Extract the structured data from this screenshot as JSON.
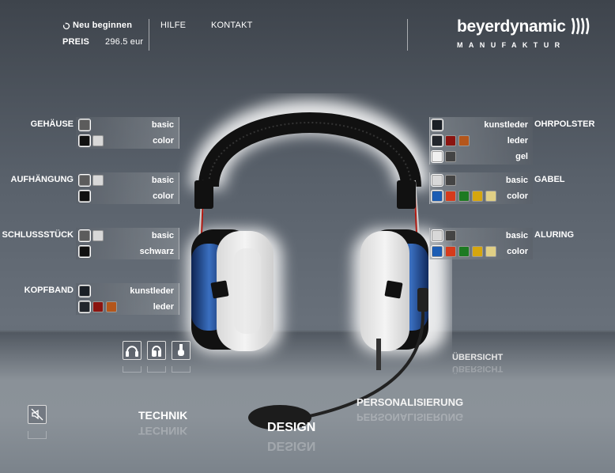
{
  "header": {
    "restart_icon": "restart-icon",
    "restart_label": "Neu beginnen",
    "price_label": "PREIS",
    "price_value": "296.5 eur",
    "menu": [
      "HILFE",
      "KONTAKT"
    ],
    "brand": "beyerdynamic",
    "brand_sub": "MANUFAKTUR"
  },
  "left": [
    {
      "category": "GEHÄUSE",
      "rows": [
        {
          "label": "basic",
          "swatches": [
            "#5c5c5c"
          ]
        },
        {
          "label": "color",
          "swatches": [
            "#111111",
            "#d8d8d8"
          ]
        }
      ]
    },
    {
      "category": "AUFHÄNGUNG",
      "rows": [
        {
          "label": "basic",
          "swatches": [
            "#5c5c5c",
            "#d8d8d8"
          ]
        },
        {
          "label": "color",
          "swatches": [
            "#111111"
          ]
        }
      ]
    },
    {
      "category": "SCHLUSSSTÜCK",
      "rows": [
        {
          "label": "basic",
          "swatches": [
            "#5c5c5c",
            "#d8d8d8"
          ]
        },
        {
          "label": "schwarz",
          "swatches": [
            "#111111"
          ]
        }
      ]
    },
    {
      "category": "KOPFBAND",
      "rows": [
        {
          "label": "kunstleder",
          "swatches": [
            "#1a1f26"
          ]
        },
        {
          "label": "leder",
          "swatches": [
            "#22262c",
            "#8b1410",
            "#b4561b"
          ]
        }
      ]
    }
  ],
  "right": [
    {
      "category": "OHRPOLSTER",
      "rows": [
        {
          "label": "kunstleder",
          "swatches": [
            "#1a1f26"
          ]
        },
        {
          "label": "leder",
          "swatches": [
            "#22262c",
            "#8b1410",
            "#b4561b"
          ]
        },
        {
          "label": "gel",
          "swatches": [
            "#f0f0f0",
            "#444444"
          ]
        }
      ]
    },
    {
      "category": "GABEL",
      "rows": [
        {
          "label": "basic",
          "swatches": [
            "#d8d8d8",
            "#444444"
          ]
        },
        {
          "label": "color",
          "swatches": [
            "#1c5db4",
            "#d63b1c",
            "#1d7a22",
            "#d6a60e",
            "#e0cf85"
          ]
        }
      ]
    },
    {
      "category": "ALURING",
      "rows": [
        {
          "label": "basic",
          "swatches": [
            "#d8d8d8",
            "#444444"
          ]
        },
        {
          "label": "color",
          "swatches": [
            "#1c5db4",
            "#d63b1c",
            "#1d7a22",
            "#d6a60e",
            "#e0cf85"
          ]
        }
      ]
    }
  ],
  "view_buttons": [
    "headphones-front-icon",
    "headphones-side-icon",
    "earpiece-icon"
  ],
  "mute_icon": "speaker-mute-icon",
  "nav": {
    "technik": "TECHNIK",
    "design": "DESIGN",
    "personalisierung": "PERSONALISIERUNG",
    "uebersicht": "ÜBERSICHT"
  }
}
